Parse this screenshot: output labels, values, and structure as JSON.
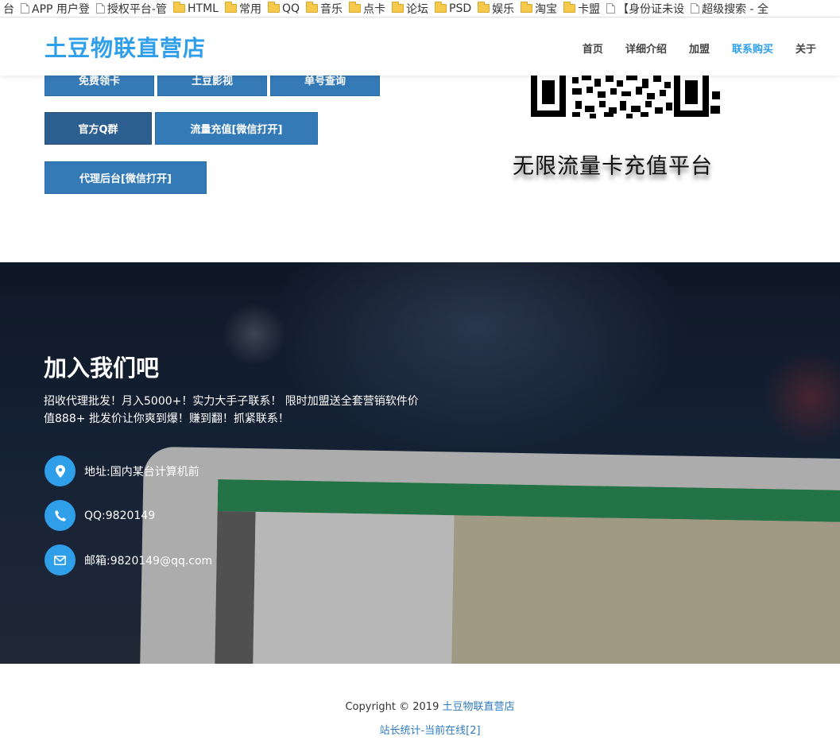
{
  "bookmarks": [
    {
      "label": "台",
      "icon": "none"
    },
    {
      "label": "APP 用户登",
      "icon": "page-icon"
    },
    {
      "label": "授权平台-管",
      "icon": "page-icon"
    },
    {
      "label": "HTML",
      "icon": "folder-icon"
    },
    {
      "label": "常用",
      "icon": "folder-icon"
    },
    {
      "label": "QQ",
      "icon": "folder-icon"
    },
    {
      "label": "音乐",
      "icon": "folder-icon"
    },
    {
      "label": "点卡",
      "icon": "folder-icon"
    },
    {
      "label": "论坛",
      "icon": "folder-icon"
    },
    {
      "label": "PSD",
      "icon": "folder-icon"
    },
    {
      "label": "娱乐",
      "icon": "folder-icon"
    },
    {
      "label": "淘宝",
      "icon": "folder-icon"
    },
    {
      "label": "卡盟",
      "icon": "folder-icon"
    },
    {
      "label": "【身份证未设",
      "icon": "page-icon"
    },
    {
      "label": "超级搜索 - 全",
      "icon": "page-icon"
    }
  ],
  "header": {
    "brand": "土豆物联直营店",
    "nav": [
      "首页",
      "详细介绍",
      "加盟",
      "联系购买",
      "关于"
    ],
    "active_nav": "联系购买"
  },
  "buttons": {
    "free_card": "免费领卡",
    "tudou_video": "土豆影视",
    "order_query": "单号查询",
    "qq_group": "官方Q群",
    "data_recharge": "流量充值[微信打开]",
    "agent_backend": "代理后台[微信打开]"
  },
  "qr": {
    "caption": "无限流量卡充值平台"
  },
  "hero": {
    "title": "加入我们吧",
    "description": "招收代理批发！月入5000+！实力大手子联系！ 限时加盟送全套营销软件价值888+ 批发价让你爽到爆！赚到翻！抓紧联系！",
    "address": "地址:国内某台计算机前",
    "qq": "QQ:9820149",
    "email": "邮箱:9820149@qq.com"
  },
  "footer": {
    "copyright_prefix": "Copyright © 2019 ",
    "copyright_link": "土豆物联直营店",
    "stats": "站长统计-当前在线[2]"
  },
  "colors": {
    "brand": "#2e9fe8",
    "button": "#337ab7",
    "button_dark": "#2c5f8f",
    "link": "#2e7bbf"
  }
}
